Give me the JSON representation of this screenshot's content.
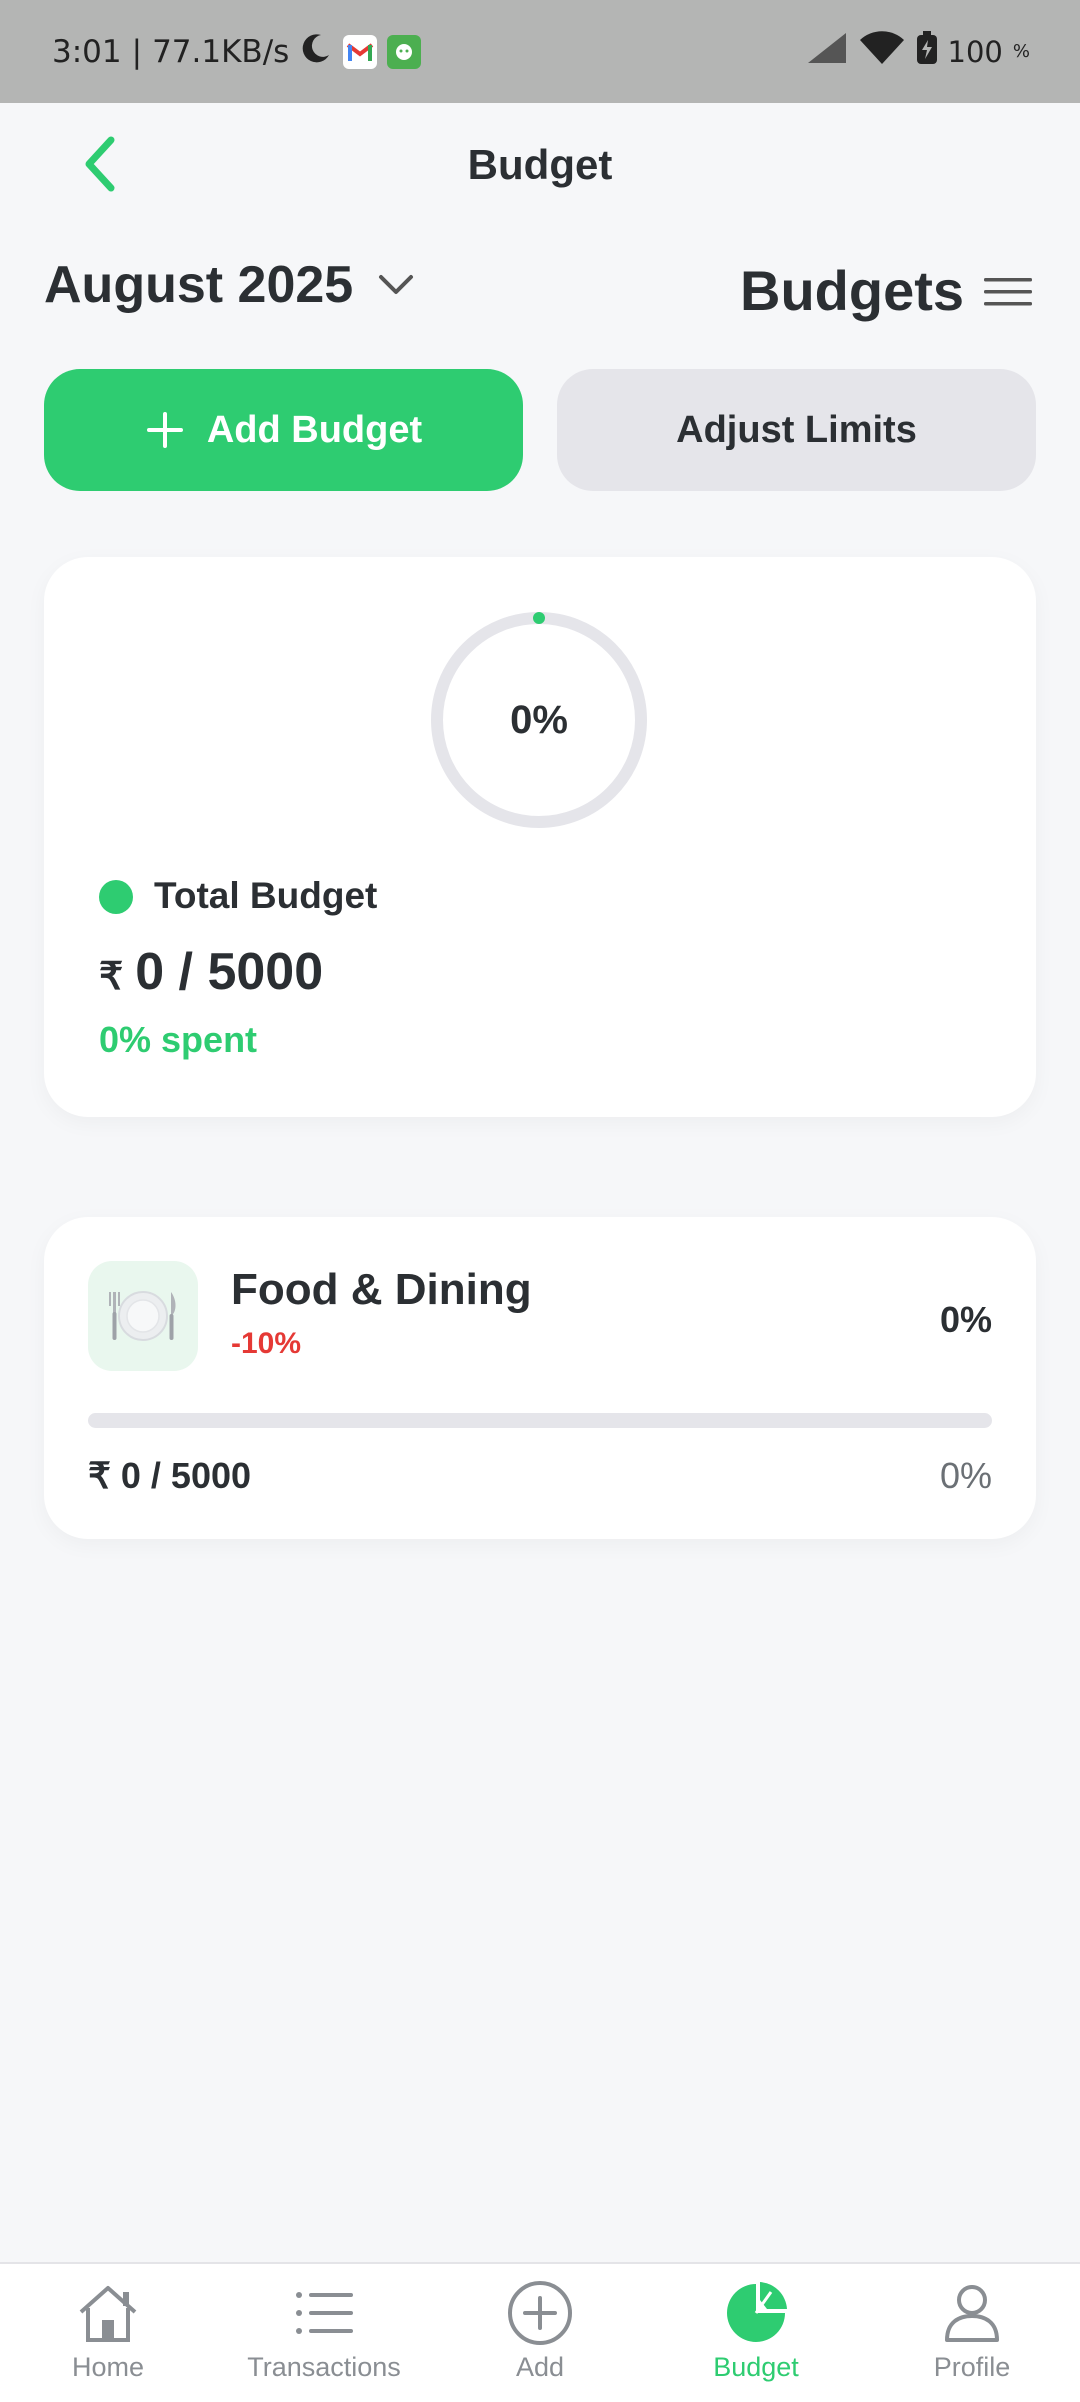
{
  "status_bar": {
    "time": "3:01",
    "speed": "77.1KB/s",
    "battery": "100"
  },
  "header": {
    "title": "Budget"
  },
  "period": {
    "month": "August 2025"
  },
  "section": {
    "heading": "Budgets"
  },
  "actions": {
    "add_label": "Add Budget",
    "adjust_label": "Adjust Limits"
  },
  "total": {
    "ring_percent": "0%",
    "ring_progress": 0,
    "label": "Total Budget",
    "currency": "₹",
    "amount": "0 / 5000",
    "spent": "0% spent",
    "accent": "#2ecc71"
  },
  "categories": [
    {
      "name": "Food & Dining",
      "icon": "plate-cutlery-icon",
      "change": "-10%",
      "percent": "0%",
      "progress": 0,
      "amount": "₹ 0 / 5000",
      "percent_bottom": "0%"
    }
  ],
  "nav": {
    "items": [
      {
        "label": "Home",
        "icon": "home-icon"
      },
      {
        "label": "Transactions",
        "icon": "list-icon"
      },
      {
        "label": "Add",
        "icon": "plus-circle-icon"
      },
      {
        "label": "Budget",
        "icon": "pie-chart-icon",
        "active": true
      },
      {
        "label": "Profile",
        "icon": "user-icon"
      }
    ]
  },
  "colors": {
    "brand_green": "#2ecc71",
    "negative_red": "#e53935"
  }
}
